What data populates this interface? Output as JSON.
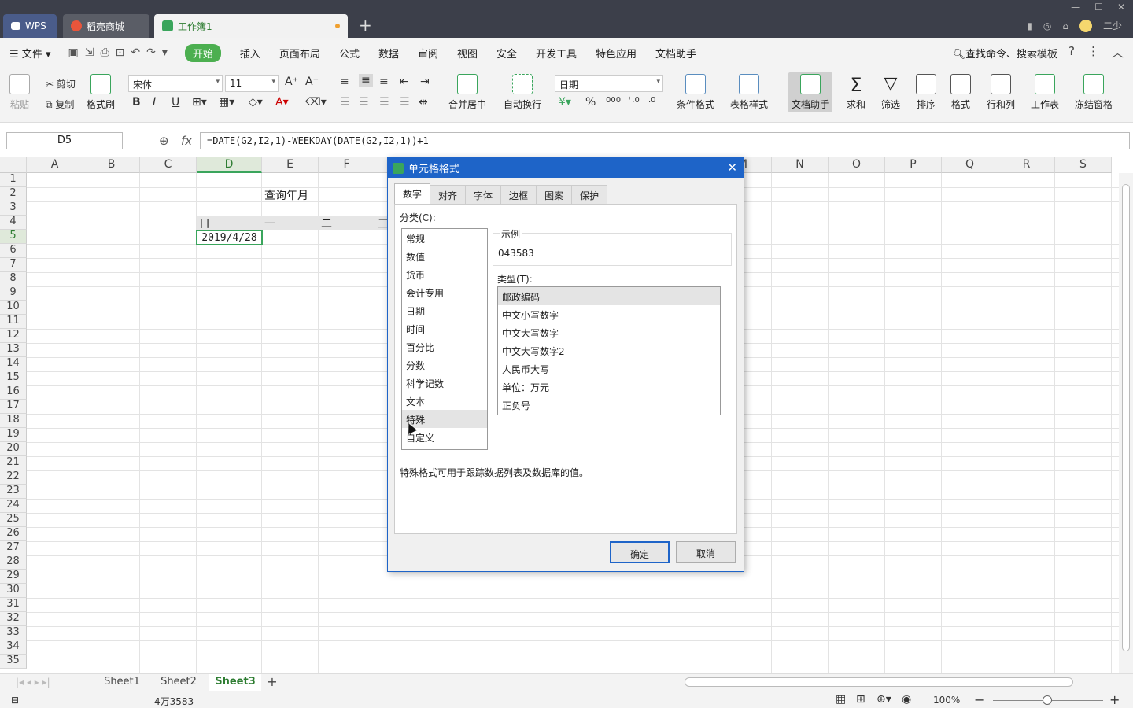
{
  "tabs": {
    "wps": "WPS",
    "shop": "稻壳商城",
    "book": "工作簿1"
  },
  "menu": {
    "file": "文件",
    "items": [
      "开始",
      "插入",
      "页面布局",
      "公式",
      "数据",
      "审阅",
      "视图",
      "安全",
      "开发工具",
      "特色应用",
      "文档助手"
    ],
    "search": "查找命令、搜索模板"
  },
  "user": {
    "name": "二少"
  },
  "ribbon": {
    "paste": "粘贴",
    "cut": "剪切",
    "copy": "复制",
    "format_painter": "格式刷",
    "font_name": "宋体",
    "font_size": "11",
    "merge_center": "合并居中",
    "wrap": "自动换行",
    "number_format": "日期",
    "cond_format": "条件格式",
    "table_style": "表格样式",
    "doc_helper": "文档助手",
    "sum": "求和",
    "filter": "筛选",
    "sort": "排序",
    "format": "格式",
    "rowcol": "行和列",
    "sheet": "工作表",
    "freeze": "冻结窗格"
  },
  "formula_bar": {
    "name_box": "D5",
    "fx": "fx",
    "formula": "=DATE(G2,I2,1)-WEEKDAY(DATE(G2,I2,1))+1"
  },
  "grid": {
    "columns": [
      "A",
      "B",
      "C",
      "D",
      "E",
      "F",
      "M",
      "N",
      "O",
      "P",
      "Q",
      "R",
      "S"
    ],
    "rows": [
      "1",
      "2",
      "3",
      "4",
      "5",
      "6",
      "7",
      "8",
      "9",
      "10",
      "11",
      "12",
      "13",
      "14",
      "15",
      "16",
      "17",
      "18",
      "19",
      "20",
      "21",
      "22",
      "23",
      "24",
      "25",
      "26",
      "27",
      "28",
      "29",
      "30",
      "31",
      "32",
      "33",
      "34",
      "35"
    ],
    "e2": "查询年月",
    "d4": "日",
    "e4": "一",
    "f4": "二",
    "g4": "三",
    "d5": "2019/4/28"
  },
  "sheets": [
    "Sheet1",
    "Sheet2",
    "Sheet3"
  ],
  "status": {
    "value": "4万3583",
    "zoom": "100%"
  },
  "dialog": {
    "title": "单元格格式",
    "tabs": [
      "数字",
      "对齐",
      "字体",
      "边框",
      "图案",
      "保护"
    ],
    "category_label": "分类(C):",
    "categories": [
      "常规",
      "数值",
      "货币",
      "会计专用",
      "日期",
      "时间",
      "百分比",
      "分数",
      "科学记数",
      "文本",
      "特殊",
      "自定义"
    ],
    "sample_label": "示例",
    "sample_value": "043583",
    "type_label": "类型(T):",
    "types": [
      "邮政编码",
      "中文小写数字",
      "中文大写数字",
      "中文大写数字2",
      "人民币大写",
      "单位：万元",
      "正负号"
    ],
    "description": "特殊格式可用于跟踪数据列表及数据库的值。",
    "ok": "确定",
    "cancel": "取消"
  },
  "colors": {
    "accent": "#1e64c8",
    "green": "#4caf50",
    "titlebar": "#3c3f4a"
  }
}
